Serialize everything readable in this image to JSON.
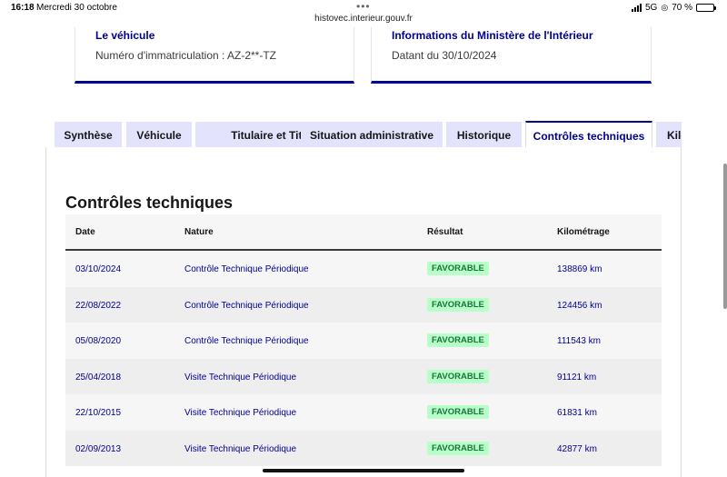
{
  "status": {
    "time": "16:18",
    "date": "Mercredi 30 octobre",
    "url": "histovec.interieur.gouv.fr",
    "network": "5G",
    "battery": "70 %",
    "battery_level": 0.7
  },
  "cards": [
    {
      "title": "Le véhicule",
      "desc": "Numéro d'immatriculation : AZ-2**-TZ"
    },
    {
      "title": "Informations du Ministère de l'Intérieur",
      "desc": "Datant du 30/10/2024"
    }
  ],
  "tabs": [
    {
      "label": "Synthèse",
      "active": false
    },
    {
      "label": "Véhicule",
      "active": false
    },
    {
      "label": "Titulaire et Titre",
      "active": false
    },
    {
      "label": "Situation administrative",
      "active": false
    },
    {
      "label": "Historique",
      "active": false
    },
    {
      "label": "Contrôles techniques",
      "active": true
    },
    {
      "label": "Kilo",
      "active": false
    }
  ],
  "section_title": "Contrôles techniques",
  "table": {
    "headers": [
      "Date",
      "Nature",
      "Résultat",
      "Kilométrage"
    ],
    "rows": [
      {
        "date": "03/10/2024",
        "nature": "Contrôle Technique Périodique",
        "result": "FAVORABLE",
        "km": "138869 km"
      },
      {
        "date": "22/08/2022",
        "nature": "Contrôle Technique Périodique",
        "result": "FAVORABLE",
        "km": "124456 km"
      },
      {
        "date": "05/08/2020",
        "nature": "Contrôle Technique Périodique",
        "result": "FAVORABLE",
        "km": "111543 km"
      },
      {
        "date": "25/04/2018",
        "nature": "Visite Technique Périodique",
        "result": "FAVORABLE",
        "km": "91121 km"
      },
      {
        "date": "22/10/2015",
        "nature": "Visite Technique Périodique",
        "result": "FAVORABLE",
        "km": "61831 km"
      },
      {
        "date": "02/09/2013",
        "nature": "Visite Technique Périodique",
        "result": "FAVORABLE",
        "km": "42877 km"
      }
    ]
  },
  "colors": {
    "accent": "#000091",
    "tab_bg": "#e3e3fd",
    "badge_bg": "#b8fec9",
    "badge_text": "#18753c"
  }
}
